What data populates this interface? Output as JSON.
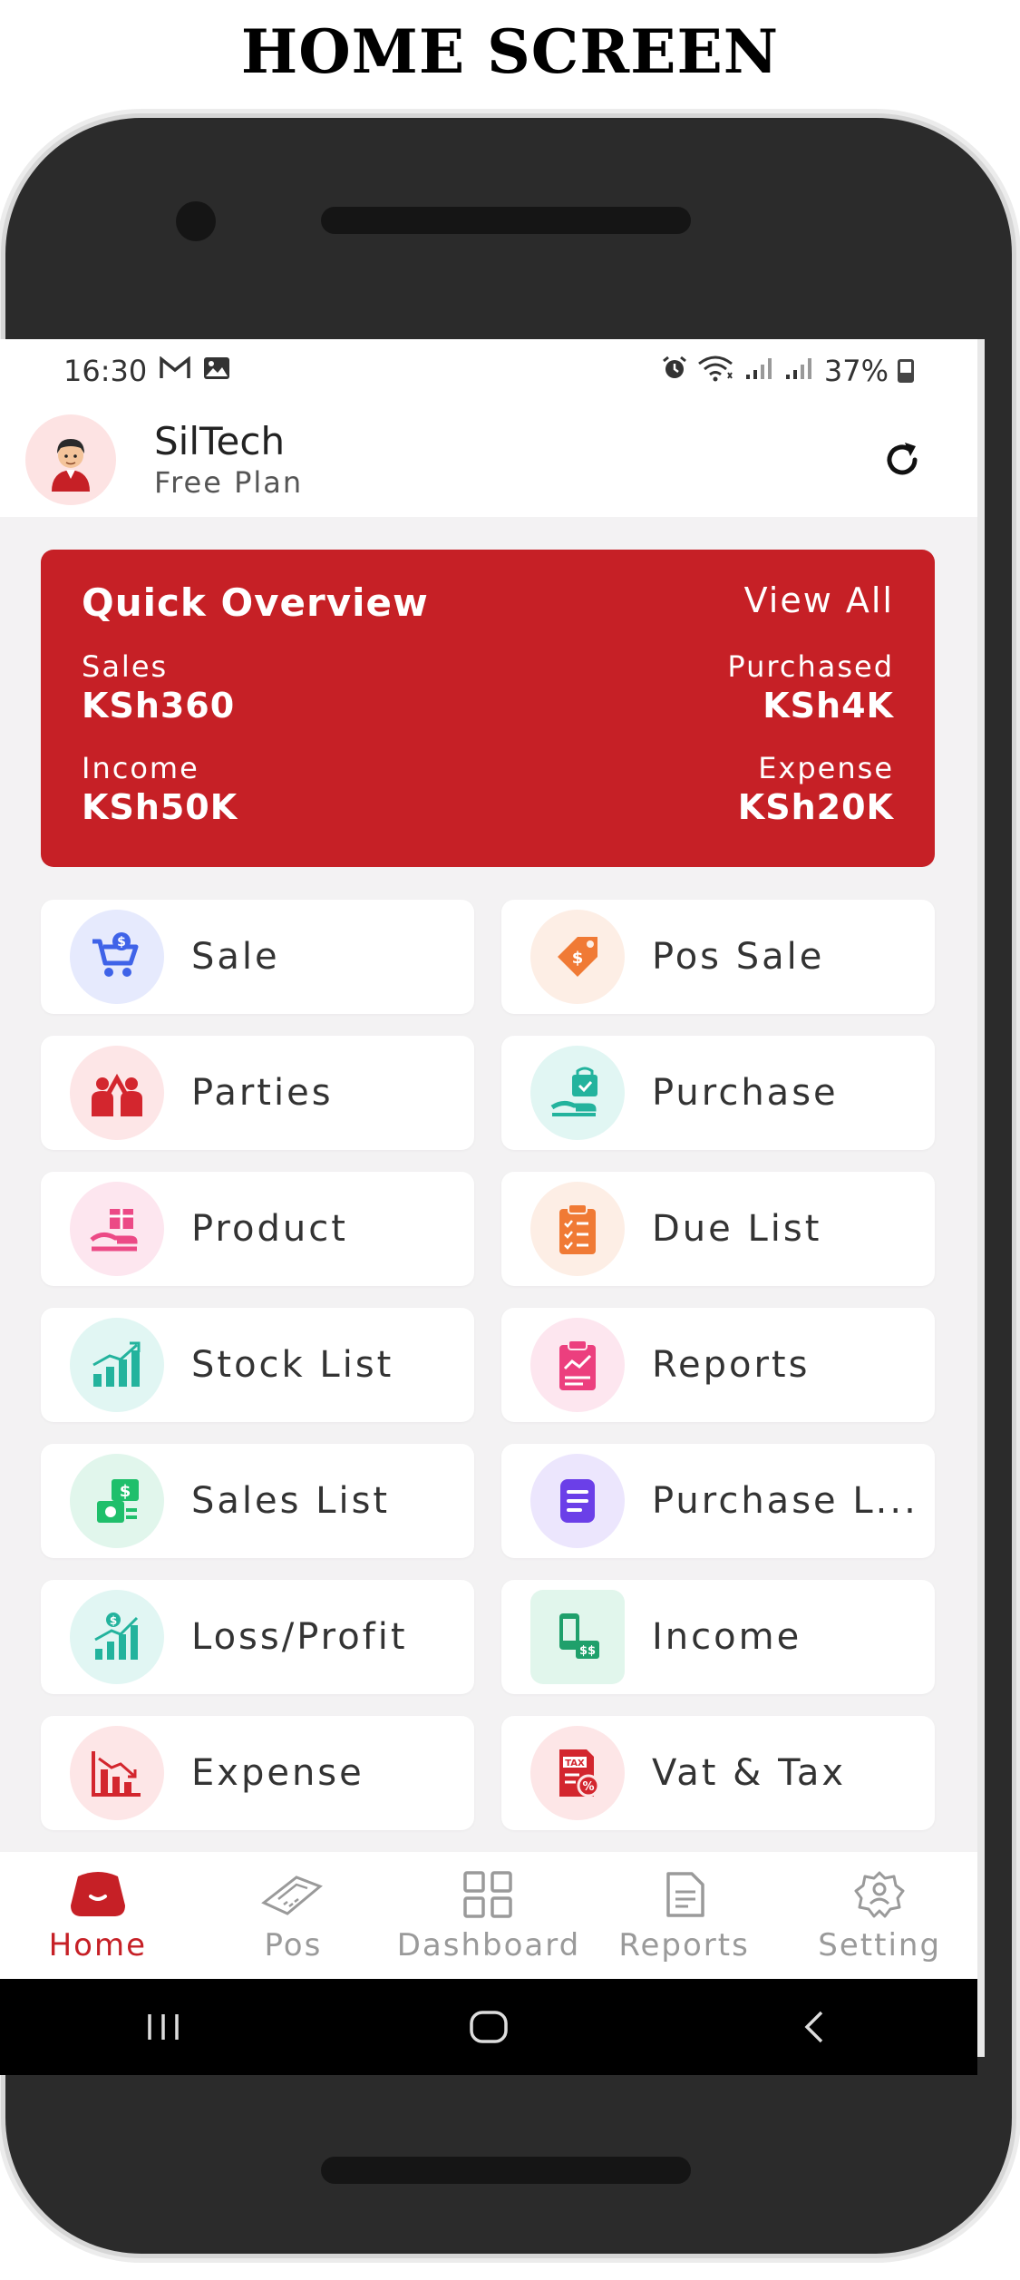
{
  "page": {
    "title": "HOME SCREEN"
  },
  "status_bar": {
    "time": "16:30",
    "battery": "37%"
  },
  "header": {
    "name": "SilTech",
    "plan": "Free Plan"
  },
  "overview": {
    "title": "Quick Overview",
    "view_all": "View All",
    "sales_label": "Sales",
    "sales_value": "KSh360",
    "purchased_label": "Purchased",
    "purchased_value": "KSh4K",
    "income_label": "Income",
    "income_value": "KSh50K",
    "expense_label": "Expense",
    "expense_value": "KSh20K"
  },
  "tiles": [
    {
      "label": "Sale",
      "icon": "cart-icon",
      "bg": "#e6eafd",
      "color": "#3f63e8"
    },
    {
      "label": "Pos Sale",
      "icon": "price-tag-icon",
      "bg": "#fdeee5",
      "color": "#f07a35"
    },
    {
      "label": "Parties",
      "icon": "parties-icon",
      "bg": "#fde6e7",
      "color": "#d3262e"
    },
    {
      "label": "Purchase",
      "icon": "purchase-icon",
      "bg": "#e1f6f3",
      "color": "#23b39d"
    },
    {
      "label": "Product",
      "icon": "gift-hand-icon",
      "bg": "#fde6ef",
      "color": "#ec4a86"
    },
    {
      "label": "Due List",
      "icon": "clipboard-icon",
      "bg": "#fdeee5",
      "color": "#f07a35"
    },
    {
      "label": "Stock List",
      "icon": "bar-growth-icon",
      "bg": "#e1f6f3",
      "color": "#23b39d"
    },
    {
      "label": "Reports",
      "icon": "report-icon",
      "bg": "#fde6ef",
      "color": "#ec3f7e"
    },
    {
      "label": "Sales List",
      "icon": "money-icon",
      "bg": "#e1f6ec",
      "color": "#1fbf6b"
    },
    {
      "label": "Purchase L...",
      "icon": "list-doc-icon",
      "bg": "#ece6fd",
      "color": "#6b3fe8"
    },
    {
      "label": "Loss/Profit",
      "icon": "profit-chart-icon",
      "bg": "#e1f6f3",
      "color": "#23b39d"
    },
    {
      "label": "Income",
      "icon": "phone-money-icon",
      "bg": "#e1f6ec",
      "color": "#1fa06b"
    },
    {
      "label": "Expense",
      "icon": "loss-chart-icon",
      "bg": "#fde6e7",
      "color": "#d3262e"
    },
    {
      "label": "Vat & Tax",
      "icon": "tax-icon",
      "bg": "#fde6e7",
      "color": "#d3262e"
    }
  ],
  "bottom_nav": [
    {
      "label": "Home",
      "active": true
    },
    {
      "label": "Pos",
      "active": false
    },
    {
      "label": "Dashboard",
      "active": false
    },
    {
      "label": "Reports",
      "active": false
    },
    {
      "label": "Setting",
      "active": false
    }
  ],
  "colors": {
    "accent": "#c62026",
    "screen_bg": "#f3f2f3"
  }
}
